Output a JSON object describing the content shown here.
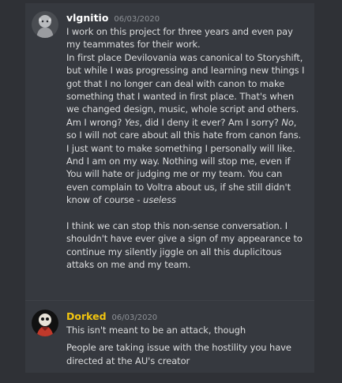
{
  "messages": [
    {
      "author": "vlgnitio",
      "timestamp": "06/03/2020",
      "avatar_icon": "gray-character-avatar",
      "author_color": "#ffffff",
      "paragraphs": [
        "I work on this project for three years and even pay my teammates for their work.",
        "In first place Devilovania was canonical to Storyshift, but while I was progressing and learning new things I got that I no longer can deal with canon to make something that I wanted in first place. That's when we changed design, music, whole script and others.",
        "Am I wrong? ",
        "Yes",
        ", did I deny it ever? Am I sorry? ",
        "No",
        ", so I will not care about all this hate from canon fans. I just want to make something I personally will like. And I am on my way. Nothing will stop me, even if You will hate or judging me or my team. You can even complain to Voltra about us, if she still didn't know of course - ",
        "useless",
        "I think we can stop this non-sense conversation. I shouldn't have ever give a sign of my appearance to continue my silently jiggle on all this duplicitous attaks on me and my team."
      ]
    },
    {
      "author": "Dorked",
      "timestamp": "06/03/2020",
      "avatar_icon": "red-skeleton-avatar",
      "author_color": "#f1c40f",
      "paragraphs": [
        "This isn't meant to be an attack, though",
        "People are taking issue with the hostility you have directed at the AU's creator"
      ]
    }
  ]
}
